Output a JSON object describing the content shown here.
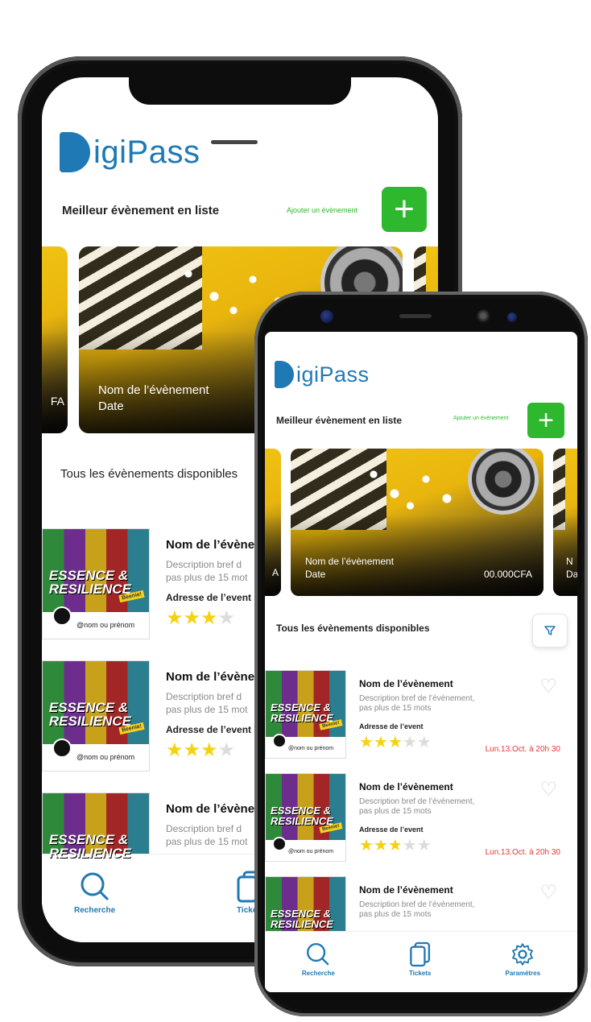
{
  "app": {
    "logo_letter": "D",
    "logo_text": "igiPass"
  },
  "header": {
    "best_events_title": "Meilleur évènement en liste",
    "add_event_label": "Ajouter un évènement",
    "add_button_symbol": "+"
  },
  "featured": [
    {
      "name": "Nom de l’évènement",
      "date": "Date",
      "price": "00.000CFA"
    }
  ],
  "featured_peek": {
    "left_price_fragment": "FA",
    "left_price_fragment_front": "A",
    "right_name_fragment": "N",
    "right_date_fragment": "Da"
  },
  "all_events": {
    "title": "Tous les évènements disponibles"
  },
  "events": [
    {
      "name": "Nom de l’évènement",
      "description": "Description bref de l’évènement, pas plus de 15 mots",
      "address": "Adresse de l’event",
      "rating": 3,
      "max_rating": 5,
      "datetime": "Lun.13.Oct. à 20h 30",
      "poster_title_line1": "ESSENCE &",
      "poster_title_line2": "RESILIENCE",
      "poster_tag": "Beenie!",
      "poster_user": "@nom ou prénom"
    },
    {
      "name": "Nom de l’évènement",
      "description": "Description bref de l’évènement, pas plus de 15 mots",
      "address": "Adresse de l’event",
      "rating": 3,
      "max_rating": 5,
      "datetime": "Lun.13.Oct. à 20h 30",
      "poster_title_line1": "ESSENCE &",
      "poster_title_line2": "RESILIENCE",
      "poster_tag": "Beenie!",
      "poster_user": "@nom ou prénom"
    },
    {
      "name": "Nom de l’évènement",
      "description": "Description bref de l’évènement, pas plus de 15 mots",
      "address": "",
      "rating": 0,
      "max_rating": 5,
      "datetime": "",
      "poster_title_line1": "ESSENCE &",
      "poster_title_line2": "RESILIENCE",
      "poster_tag": "",
      "poster_user": ""
    }
  ],
  "back_phone_truncated": {
    "name": "Nom de l’évène",
    "desc_line1": "Description bref d",
    "desc_line2": "pas plus de 15 mot",
    "address": "Adresse de l’event",
    "all_events_title": "Tous les évènements disponibles"
  },
  "nav": [
    {
      "label": "Recherche",
      "icon": "search-icon"
    },
    {
      "label": "Tickets",
      "icon": "tickets-icon"
    },
    {
      "label": "Paramètres",
      "icon": "gear-icon"
    }
  ],
  "colors": {
    "brand_blue": "#1f79b4",
    "green": "#2eb82e",
    "red": "#e53935",
    "star": "#f5d20f"
  }
}
